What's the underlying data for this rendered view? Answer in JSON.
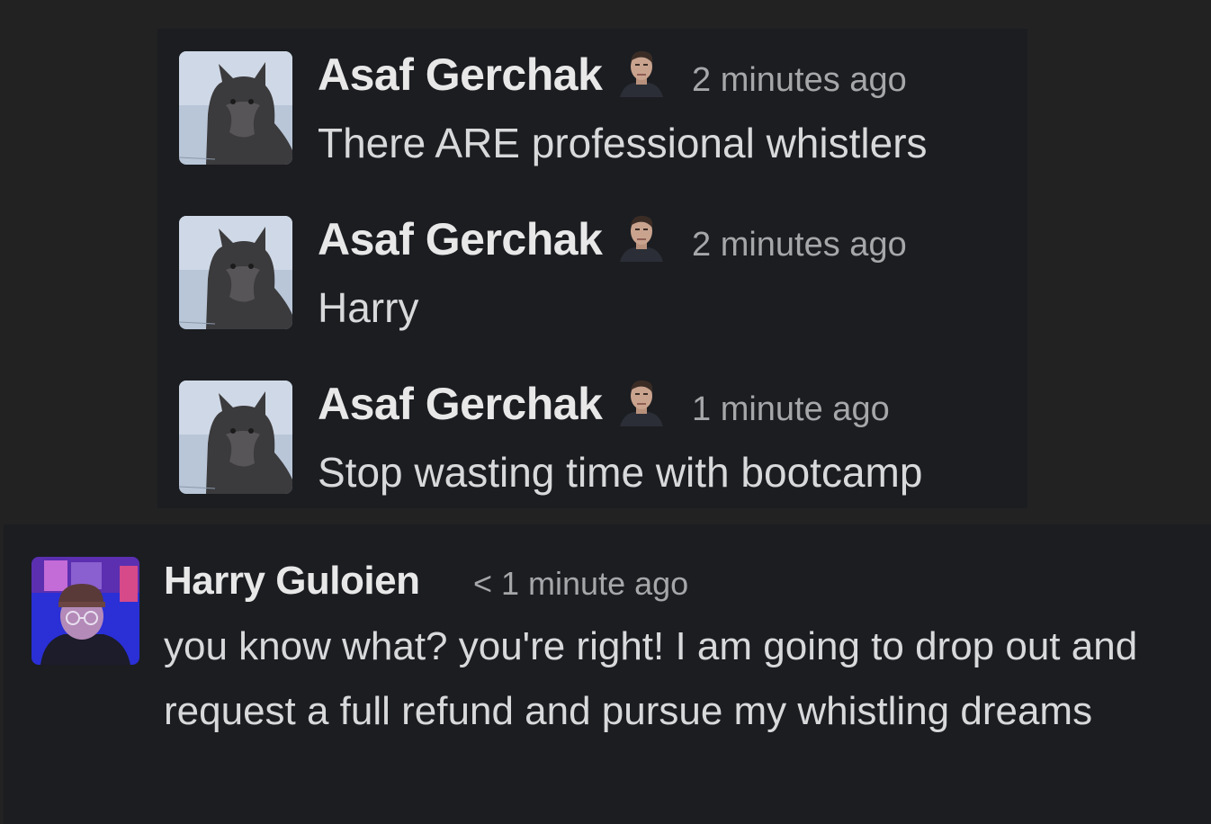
{
  "quoted_messages": [
    {
      "author": "Asaf Gerchak",
      "avatar_icon": "cat-avatar-icon",
      "status_icon": "face-status-emoji-icon",
      "timestamp": "2 minutes ago",
      "text": "There ARE professional whistlers"
    },
    {
      "author": "Asaf Gerchak",
      "avatar_icon": "cat-avatar-icon",
      "status_icon": "face-status-emoji-icon",
      "timestamp": "2 minutes ago",
      "text": "Harry"
    },
    {
      "author": "Asaf Gerchak",
      "avatar_icon": "cat-avatar-icon",
      "status_icon": "face-status-emoji-icon",
      "timestamp": "1 minute ago",
      "text": "Stop wasting time with bootcamp"
    }
  ],
  "reply": {
    "author": "Harry Guloien",
    "avatar_icon": "person-avatar-icon",
    "timestamp": "< 1 minute ago",
    "text": "you know what? you're right! I am going to drop out and request a full refund and pursue my whistling dreams"
  },
  "colors": {
    "page_background": "#222223",
    "message_background": "#1b1d21",
    "author_text": "#e8e8e8",
    "timestamp_text": "#a6a7a9",
    "body_text": "#d8d9da"
  }
}
